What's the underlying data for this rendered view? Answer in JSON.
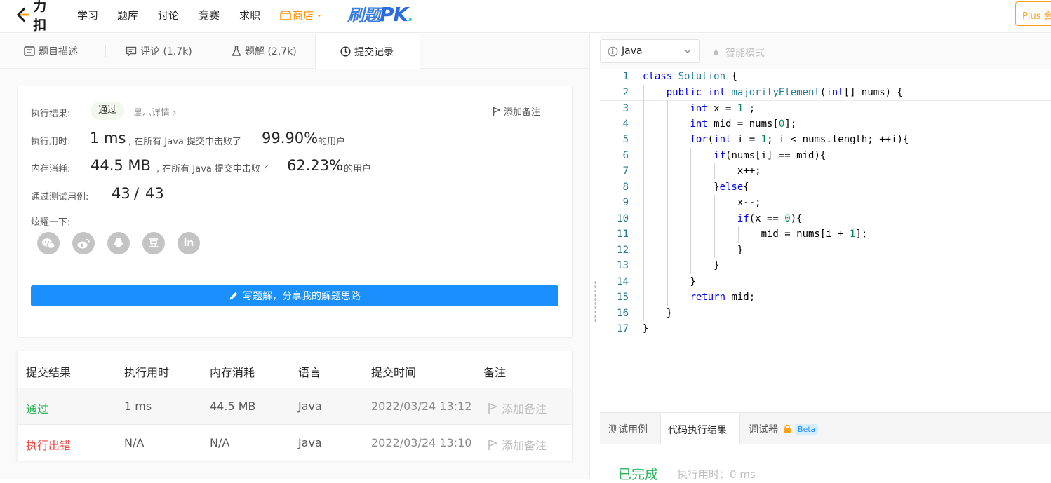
{
  "nav": {
    "brand": "力扣",
    "items": [
      "学习",
      "题库",
      "讨论",
      "竞赛",
      "求职"
    ],
    "store": "商店",
    "pk_main": "刷题",
    "pk_big": "PK",
    "pk_dot": ".",
    "plus": "Plus 会"
  },
  "left_tabs": {
    "description": "题目描述",
    "comments": "评论 (1.7k)",
    "solutions": "题解 (2.7k)",
    "submissions": "提交记录"
  },
  "result": {
    "status_label": "执行结果:",
    "status": "通过",
    "show_detail": "显示详情 ›",
    "add_note": "添加备注",
    "runtime_label": "执行用时:",
    "runtime": "1 ms",
    "runtime_beat_text": ", 在所有 Java 提交中击败了",
    "runtime_percent": "99.90%",
    "users": "的用户",
    "memory_label": "内存消耗:",
    "memory": "44.5 MB",
    "memory_beat_text": ", 在所有 Java 提交中击败了",
    "memory_percent": "62.23%",
    "testcase_label": "通过测试用例:",
    "testcase_passed": "43",
    "testcase_sep": "/",
    "testcase_total": "43",
    "share_label": "炫耀一下:",
    "share_icons": [
      "wechat-icon",
      "weibo-icon",
      "qq-icon",
      "douban-icon",
      "linkedin-icon"
    ],
    "share_glyphs": {
      "douban": "豆",
      "linkedin": "in"
    },
    "write_button": "写题解，分享我的解题思路"
  },
  "submissions": {
    "headers": [
      "提交结果",
      "执行用时",
      "内存消耗",
      "语言",
      "提交时间",
      "备注"
    ],
    "rows": [
      {
        "result": "通过",
        "runtime": "1 ms",
        "memory": "44.5 MB",
        "lang": "Java",
        "time": "2022/03/24 13:12",
        "note": "添加备注"
      },
      {
        "result": "执行出错",
        "runtime": "N/A",
        "memory": "N/A",
        "lang": "Java",
        "time": "2022/03/24 13:10",
        "note": "添加备注"
      }
    ]
  },
  "editor": {
    "language": "Java",
    "smart_mode": "智能模式",
    "lines": [
      "class Solution {",
      "    public int majorityElement(int[] nums) {",
      "        int x = 1 ;",
      "        int mid = nums[0];",
      "        for(int i = 1; i < nums.length; ++i){",
      "            if(nums[i] == mid){",
      "                x++;",
      "            }else{",
      "                x--;",
      "                if(x == 0){",
      "                    mid = nums[i + 1];",
      "                }",
      "            }",
      "        }",
      "        return mid;",
      "    }",
      "}"
    ]
  },
  "bottom": {
    "tab_testcase": "测试用例",
    "tab_result": "代码执行结果",
    "tab_debugger": "调试器",
    "beta": "Beta",
    "done": "已完成",
    "exec_time": "执行用时：0 ms"
  },
  "colors": {
    "accent": "#1a90ff",
    "success": "#2db55d",
    "error": "#ef4743",
    "store": "#ff8f00",
    "plus": "#ffa116"
  }
}
